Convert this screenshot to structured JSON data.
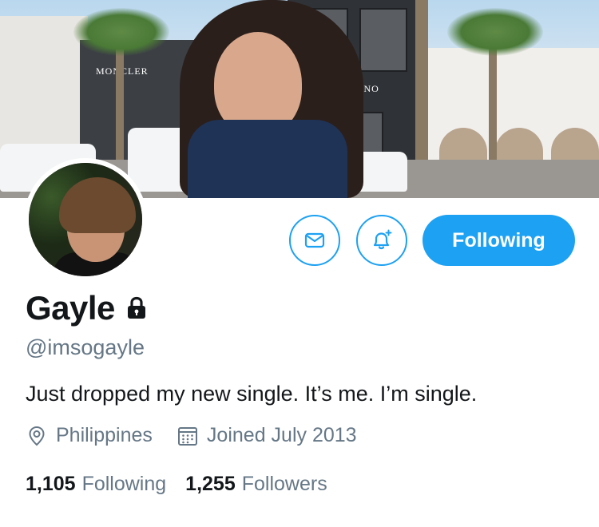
{
  "profile": {
    "display_name": "Gayle",
    "handle": "@imsogayle",
    "bio": "Just dropped my new single. It’s me. I’m single.",
    "location": "Philippines",
    "joined": "Joined July 2013",
    "protected": true
  },
  "banner": {
    "sign_left": "MONCLER",
    "sign_mid": "VALENTINO"
  },
  "actions": {
    "follow_label": "Following",
    "dm_icon": "mail-icon",
    "notify_icon": "bell-plus-icon"
  },
  "stats": {
    "following_count": "1,105",
    "following_label": "Following",
    "followers_count": "1,255",
    "followers_label": "Followers"
  },
  "colors": {
    "accent": "#1da1f2",
    "secondary_text": "#657786",
    "primary_text": "#14171a"
  }
}
